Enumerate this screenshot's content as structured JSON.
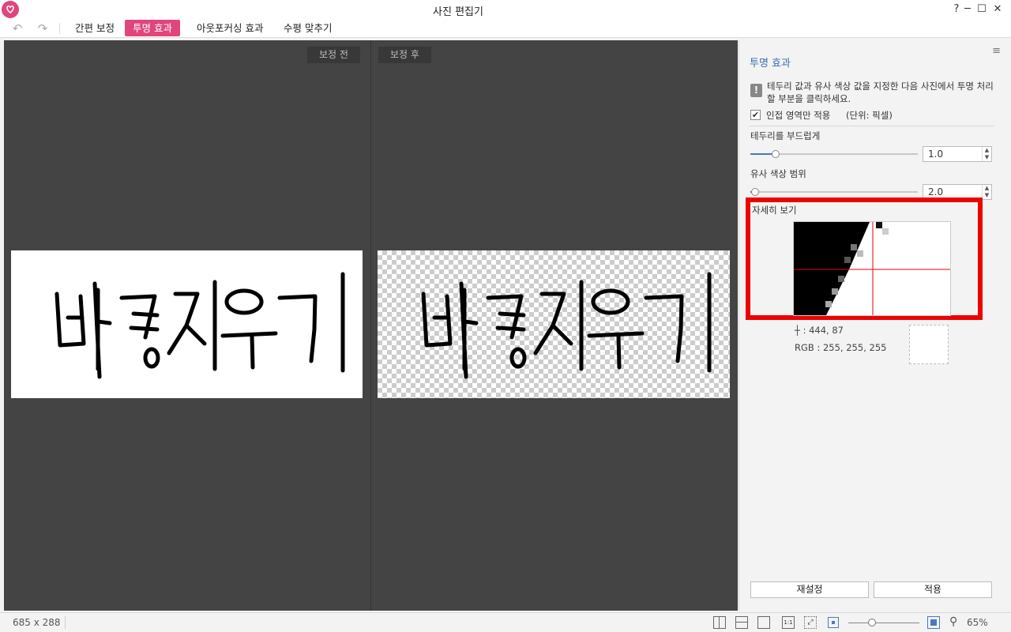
{
  "window": {
    "title": "사진 편집기",
    "help_label": "?",
    "minimize_label": "─",
    "maximize_label": "☐",
    "close_label": "✕"
  },
  "toolbar": {
    "undo_icon": "undo-icon",
    "redo_icon": "redo-icon",
    "tabs": [
      {
        "label": "간편 보정",
        "active": false
      },
      {
        "label": "투명 효과",
        "active": true
      },
      {
        "label": "아웃포커싱 효과",
        "active": false
      },
      {
        "label": "수평 맞추기",
        "active": false
      }
    ]
  },
  "canvas": {
    "before_label": "보정 전",
    "after_label": "보정 후",
    "image_text": "배경지우기"
  },
  "panel": {
    "title": "투명 효과",
    "info_text": "테두리 값과 유사 색상 값을 지정한 다음 사진에서 투명 처리할 부분을 클릭하세요.",
    "adjacent_only_label": "인접 영역만 적용",
    "adjacent_only_checked": true,
    "unit_label": "(단위: 픽셀)",
    "edge_label": "테두리를 부드럽게",
    "edge_value": "1.0",
    "edge_level": 0.15,
    "similar_label": "유사 색상 범위",
    "similar_value": "2.0",
    "similar_level": 0.03,
    "detail_label": "자세히 보기",
    "coord_text": "┼ : 444, 87",
    "rgb_text": "RGB : 255, 255, 255",
    "reset_label": "재설정",
    "apply_label": "적용",
    "accent_color": "#e0457b",
    "highlight_color": "#ee0000"
  },
  "status": {
    "dimensions": "685 x 288",
    "zoom_percent": "65%",
    "zoom_level": 0.33
  }
}
